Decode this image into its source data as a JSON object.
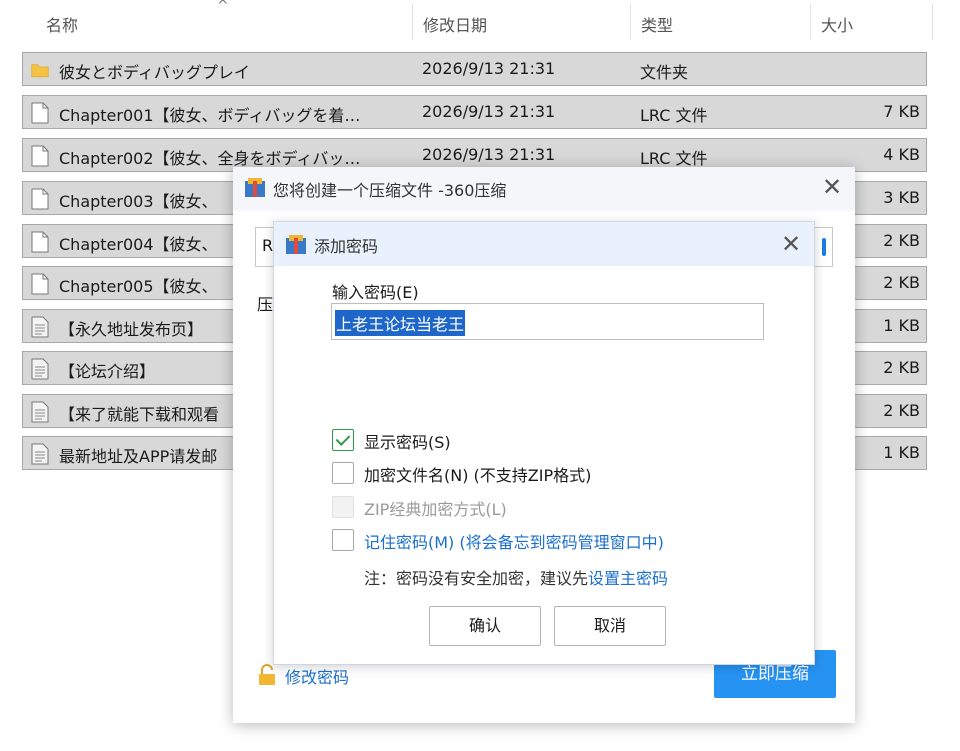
{
  "columns": {
    "name": "名称",
    "date": "修改日期",
    "type": "类型",
    "size": "大小"
  },
  "files": [
    {
      "icon": "folder-icon",
      "name": "彼女とボディバッグプレイ",
      "date": "2026/9/13 21:31",
      "type": "文件夹",
      "size": ""
    },
    {
      "icon": "file-icon",
      "name": "Chapter001【彼女、ボディバッグを着…",
      "date": "2026/9/13 21:31",
      "type": "LRC 文件",
      "size": "7 KB"
    },
    {
      "icon": "file-icon",
      "name": "Chapter002【彼女、全身をボディバッ…",
      "date": "2026/9/13 21:31",
      "type": "LRC 文件",
      "size": "4 KB"
    },
    {
      "icon": "file-icon",
      "name": "Chapter003【彼女、",
      "date": "",
      "type": "",
      "size": "3 KB"
    },
    {
      "icon": "file-icon",
      "name": "Chapter004【彼女、",
      "date": "",
      "type": "",
      "size": "2 KB"
    },
    {
      "icon": "file-icon",
      "name": "Chapter005【彼女、",
      "date": "",
      "type": "",
      "size": "2 KB"
    },
    {
      "icon": "text-file-icon",
      "name": "【永久地址发布页】",
      "date": "",
      "type": "",
      "size": "1 KB"
    },
    {
      "icon": "text-file-icon",
      "name": "【论坛介绍】",
      "date": "",
      "type": "",
      "size": "2 KB"
    },
    {
      "icon": "text-file-icon",
      "name": "【来了就能下载和观看",
      "date": "",
      "type": "",
      "size": "2 KB"
    },
    {
      "icon": "text-file-icon",
      "name": "最新地址及APP请发邮",
      "date": "",
      "type": "",
      "size": "1 KB"
    }
  ],
  "outer_dialog": {
    "title": "您将创建一个压缩文件 -360压缩",
    "input_stub": "R",
    "label_stub": "压",
    "change_password": "修改密码",
    "compress_button": "立即压缩"
  },
  "inner_dialog": {
    "title": "添加密码",
    "password_label": "输入密码(E)",
    "password_value": "上老王论坛当老王",
    "checkboxes": [
      {
        "label": "显示密码(S)",
        "checked": true,
        "disabled": false
      },
      {
        "label": "加密文件名(N) (不支持ZIP格式)",
        "checked": false,
        "disabled": false
      },
      {
        "label": "ZIP经典加密方式(L)",
        "checked": false,
        "disabled": true
      },
      {
        "label": "记住密码(M) (将会备忘到密码管理窗口中)",
        "checked": false,
        "disabled": false
      }
    ],
    "note_prefix": "注：密码没有安全加密，建议先",
    "note_link": "设置主密码",
    "ok_button": "确认",
    "cancel_button": "取消"
  },
  "colors": {
    "accent_blue": "#2693f2",
    "link_blue": "#1b6fce",
    "check_green": "#2f9a4a",
    "folder_yellow": "#f5c242"
  }
}
